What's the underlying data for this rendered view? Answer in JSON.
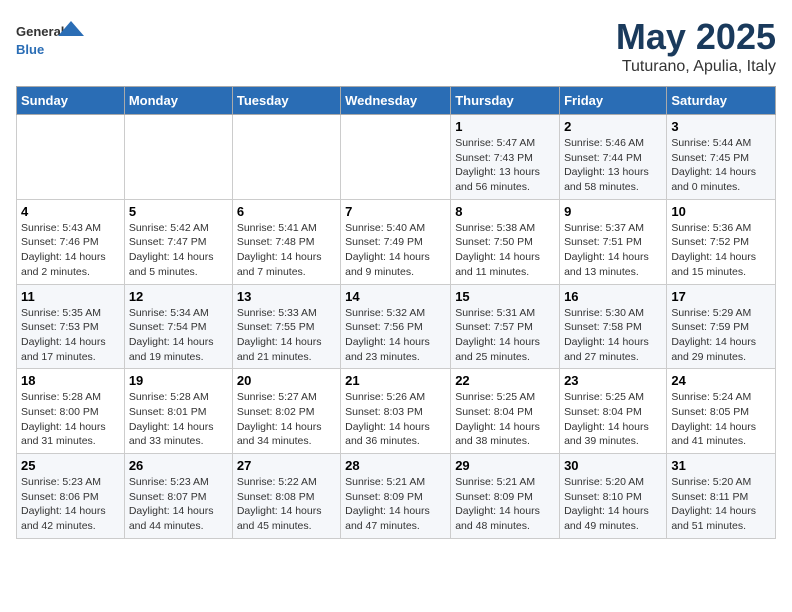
{
  "header": {
    "logo_general": "General",
    "logo_blue": "Blue",
    "title": "May 2025",
    "subtitle": "Tuturano, Apulia, Italy"
  },
  "days_of_week": [
    "Sunday",
    "Monday",
    "Tuesday",
    "Wednesday",
    "Thursday",
    "Friday",
    "Saturday"
  ],
  "weeks": [
    [
      {
        "day": "",
        "info": ""
      },
      {
        "day": "",
        "info": ""
      },
      {
        "day": "",
        "info": ""
      },
      {
        "day": "",
        "info": ""
      },
      {
        "day": "1",
        "info": "Sunrise: 5:47 AM\nSunset: 7:43 PM\nDaylight: 13 hours\nand 56 minutes."
      },
      {
        "day": "2",
        "info": "Sunrise: 5:46 AM\nSunset: 7:44 PM\nDaylight: 13 hours\nand 58 minutes."
      },
      {
        "day": "3",
        "info": "Sunrise: 5:44 AM\nSunset: 7:45 PM\nDaylight: 14 hours\nand 0 minutes."
      }
    ],
    [
      {
        "day": "4",
        "info": "Sunrise: 5:43 AM\nSunset: 7:46 PM\nDaylight: 14 hours\nand 2 minutes."
      },
      {
        "day": "5",
        "info": "Sunrise: 5:42 AM\nSunset: 7:47 PM\nDaylight: 14 hours\nand 5 minutes."
      },
      {
        "day": "6",
        "info": "Sunrise: 5:41 AM\nSunset: 7:48 PM\nDaylight: 14 hours\nand 7 minutes."
      },
      {
        "day": "7",
        "info": "Sunrise: 5:40 AM\nSunset: 7:49 PM\nDaylight: 14 hours\nand 9 minutes."
      },
      {
        "day": "8",
        "info": "Sunrise: 5:38 AM\nSunset: 7:50 PM\nDaylight: 14 hours\nand 11 minutes."
      },
      {
        "day": "9",
        "info": "Sunrise: 5:37 AM\nSunset: 7:51 PM\nDaylight: 14 hours\nand 13 minutes."
      },
      {
        "day": "10",
        "info": "Sunrise: 5:36 AM\nSunset: 7:52 PM\nDaylight: 14 hours\nand 15 minutes."
      }
    ],
    [
      {
        "day": "11",
        "info": "Sunrise: 5:35 AM\nSunset: 7:53 PM\nDaylight: 14 hours\nand 17 minutes."
      },
      {
        "day": "12",
        "info": "Sunrise: 5:34 AM\nSunset: 7:54 PM\nDaylight: 14 hours\nand 19 minutes."
      },
      {
        "day": "13",
        "info": "Sunrise: 5:33 AM\nSunset: 7:55 PM\nDaylight: 14 hours\nand 21 minutes."
      },
      {
        "day": "14",
        "info": "Sunrise: 5:32 AM\nSunset: 7:56 PM\nDaylight: 14 hours\nand 23 minutes."
      },
      {
        "day": "15",
        "info": "Sunrise: 5:31 AM\nSunset: 7:57 PM\nDaylight: 14 hours\nand 25 minutes."
      },
      {
        "day": "16",
        "info": "Sunrise: 5:30 AM\nSunset: 7:58 PM\nDaylight: 14 hours\nand 27 minutes."
      },
      {
        "day": "17",
        "info": "Sunrise: 5:29 AM\nSunset: 7:59 PM\nDaylight: 14 hours\nand 29 minutes."
      }
    ],
    [
      {
        "day": "18",
        "info": "Sunrise: 5:28 AM\nSunset: 8:00 PM\nDaylight: 14 hours\nand 31 minutes."
      },
      {
        "day": "19",
        "info": "Sunrise: 5:28 AM\nSunset: 8:01 PM\nDaylight: 14 hours\nand 33 minutes."
      },
      {
        "day": "20",
        "info": "Sunrise: 5:27 AM\nSunset: 8:02 PM\nDaylight: 14 hours\nand 34 minutes."
      },
      {
        "day": "21",
        "info": "Sunrise: 5:26 AM\nSunset: 8:03 PM\nDaylight: 14 hours\nand 36 minutes."
      },
      {
        "day": "22",
        "info": "Sunrise: 5:25 AM\nSunset: 8:04 PM\nDaylight: 14 hours\nand 38 minutes."
      },
      {
        "day": "23",
        "info": "Sunrise: 5:25 AM\nSunset: 8:04 PM\nDaylight: 14 hours\nand 39 minutes."
      },
      {
        "day": "24",
        "info": "Sunrise: 5:24 AM\nSunset: 8:05 PM\nDaylight: 14 hours\nand 41 minutes."
      }
    ],
    [
      {
        "day": "25",
        "info": "Sunrise: 5:23 AM\nSunset: 8:06 PM\nDaylight: 14 hours\nand 42 minutes."
      },
      {
        "day": "26",
        "info": "Sunrise: 5:23 AM\nSunset: 8:07 PM\nDaylight: 14 hours\nand 44 minutes."
      },
      {
        "day": "27",
        "info": "Sunrise: 5:22 AM\nSunset: 8:08 PM\nDaylight: 14 hours\nand 45 minutes."
      },
      {
        "day": "28",
        "info": "Sunrise: 5:21 AM\nSunset: 8:09 PM\nDaylight: 14 hours\nand 47 minutes."
      },
      {
        "day": "29",
        "info": "Sunrise: 5:21 AM\nSunset: 8:09 PM\nDaylight: 14 hours\nand 48 minutes."
      },
      {
        "day": "30",
        "info": "Sunrise: 5:20 AM\nSunset: 8:10 PM\nDaylight: 14 hours\nand 49 minutes."
      },
      {
        "day": "31",
        "info": "Sunrise: 5:20 AM\nSunset: 8:11 PM\nDaylight: 14 hours\nand 51 minutes."
      }
    ]
  ]
}
